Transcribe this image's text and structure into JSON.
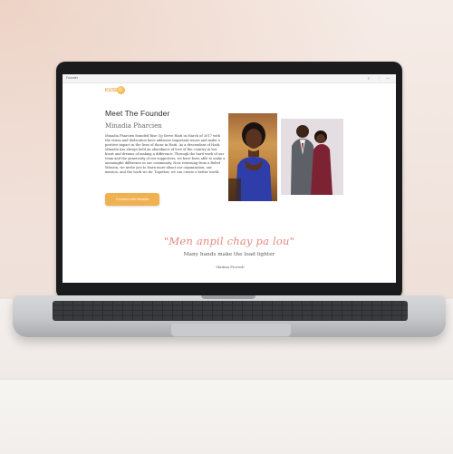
{
  "browser": {
    "tab_title": "Founder",
    "controls": [
      "⇪",
      "⋮",
      "—"
    ]
  },
  "header": {
    "logo_text": "KUSE"
  },
  "founder": {
    "section_title": "Meet The Founder",
    "name": "Minadia Pharcien",
    "bio": "Minadia Pharcien founded Rise Up Serve Haiti in March of 2017 with the vision and dedication have addresse important issues and make a positive impact in the lives of those in Haiti. As a descendant of Haiti, Minadia has always held an abundance of love of the country in her heart and dreams of making a difference. Through the hard work of our team and the generosity of our supporters, we have been able to make a meaningful difference in our community. Now returning from a Relief Mission, we invite you to learn more about our organization, our mission, and the work we do. Together, we can create a better world.",
    "cta_label": "Connect with Minadia"
  },
  "photos": {
    "portrait_alt": "founder-portrait",
    "couple_alt": "founder-couple"
  },
  "quote": {
    "text": "\"Men anpil chay pa lou\"",
    "translation": "Many hands make the load lighter",
    "attribution": "- Haitian Proverb"
  },
  "colors": {
    "accent": "#f0b251",
    "quote": "#e4877c",
    "text": "#2d2d2d"
  }
}
